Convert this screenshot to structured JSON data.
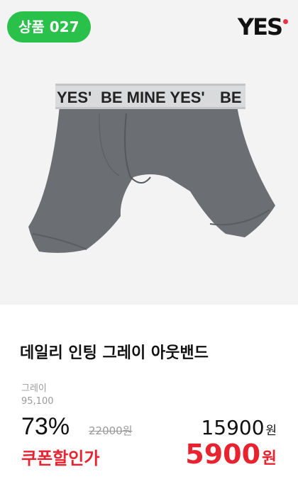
{
  "badge": {
    "label": "상품 027",
    "color": "#2ac14a"
  },
  "brand": {
    "logo_text": "YES",
    "accent": "#e8334a"
  },
  "product": {
    "image_icon": "boxer-briefs-image",
    "waistband_text": "BE MINE YES'",
    "title": "데일리 인팅 그레이 아웃밴드",
    "option_name": "그레이",
    "option_code": "95,100"
  },
  "pricing": {
    "discount_rate": "73%",
    "original_price": "22000원",
    "sale_price": "15900",
    "sale_unit": "원",
    "coupon_label": "쿠폰할인가",
    "coupon_price": "5900",
    "coupon_unit": "원",
    "coupon_color": "#e8232f"
  }
}
